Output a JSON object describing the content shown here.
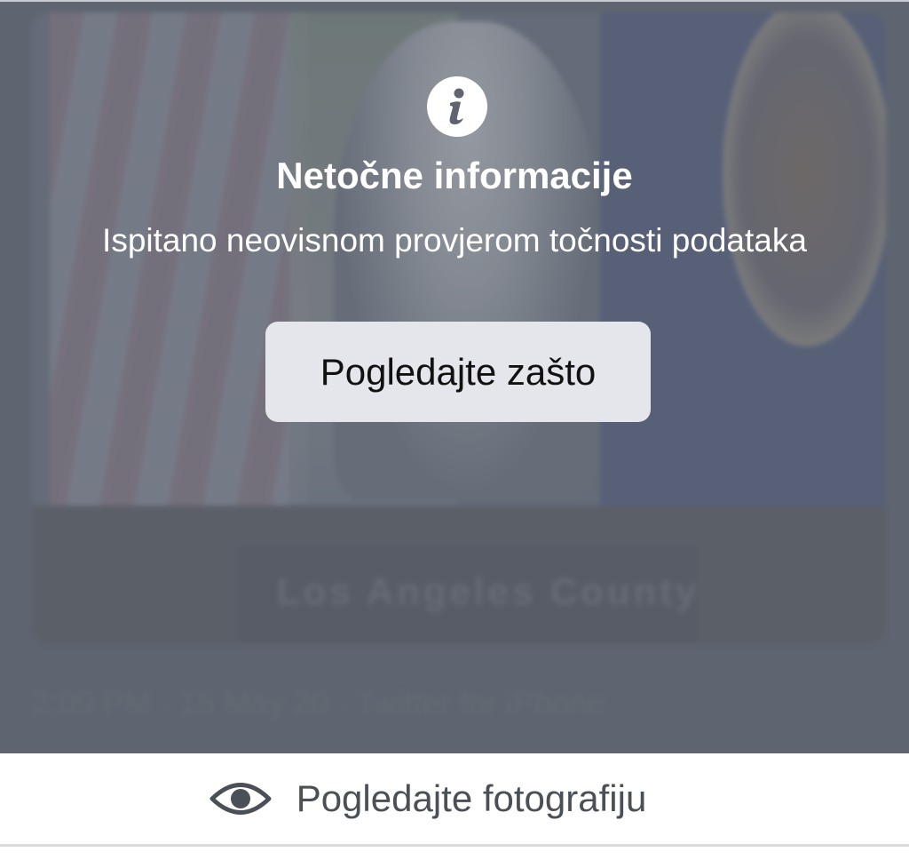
{
  "background_photo": {
    "podium_text": "Los Angeles County",
    "caption": "2:09 PM · 15 May 20 · Twitter for iPhone"
  },
  "warning": {
    "icon": "info-icon",
    "title": "Netočne informacije",
    "subtitle": "Ispitano neovisnom provjerom točnosti podataka",
    "button_label": "Pogledajte zašto"
  },
  "view_photo": {
    "icon": "eye-icon",
    "label": "Pogledajte fotografiju"
  },
  "colors": {
    "overlay": "#636873",
    "button_bg": "#e5e6eb",
    "text_on_overlay": "#ffffff",
    "view_label": "#4b4f56"
  }
}
